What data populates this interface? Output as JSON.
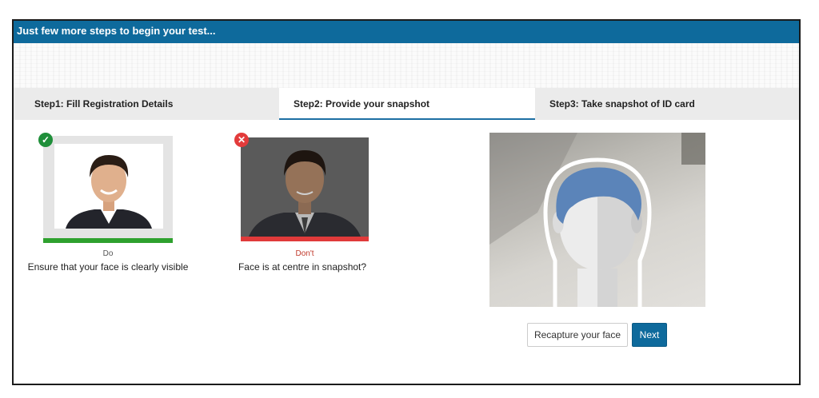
{
  "header": {
    "title": "Just few more steps to begin your test..."
  },
  "steps": [
    {
      "label": "Step1: Fill Registration Details"
    },
    {
      "label": "Step2: Provide your snapshot",
      "active": true
    },
    {
      "label": "Step3: Take snapshot of ID card"
    }
  ],
  "samples": {
    "do": {
      "badge": "✓",
      "title": "Do",
      "text": "Ensure that your face is clearly visible"
    },
    "dont": {
      "badge": "✕",
      "title": "Don't",
      "text": "Face is at centre in snapshot?"
    }
  },
  "buttons": {
    "recapture": "Recapture your face",
    "next": "Next"
  },
  "colors": {
    "header": "#0e6a9c",
    "active_tab_underline": "#1d6fa3",
    "do_bar": "#2ea12e",
    "dont_bar": "#e03a3a",
    "next_button": "#0e6a9c"
  }
}
